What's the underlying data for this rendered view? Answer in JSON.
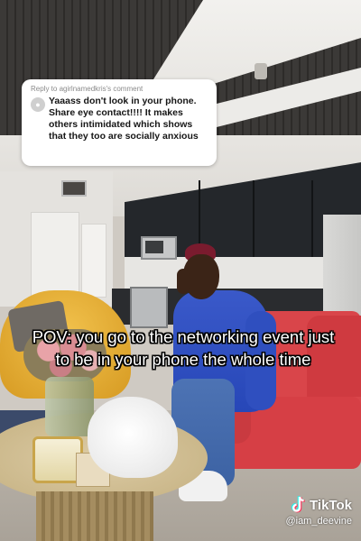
{
  "comment": {
    "reply_to": "Reply to agirlnamedkris's comment",
    "text": "Yaaass don't look in your phone. Share eye contact!!!! It makes others intimidated which shows that they too are socially anxious"
  },
  "caption": "POV: you go to the networking event just to be in your phone the whole time",
  "watermark": {
    "brand": "TikTok",
    "handle": "@iam_deevine"
  },
  "icons": {
    "avatar": "user-avatar-icon",
    "logo": "tiktok-note-icon"
  },
  "colors": {
    "caption_text": "#ffffff",
    "caption_outline": "#000000",
    "bubble_bg": "#ffffff",
    "tiktok_cyan": "#25f4ee",
    "tiktok_red": "#fe2c55"
  }
}
